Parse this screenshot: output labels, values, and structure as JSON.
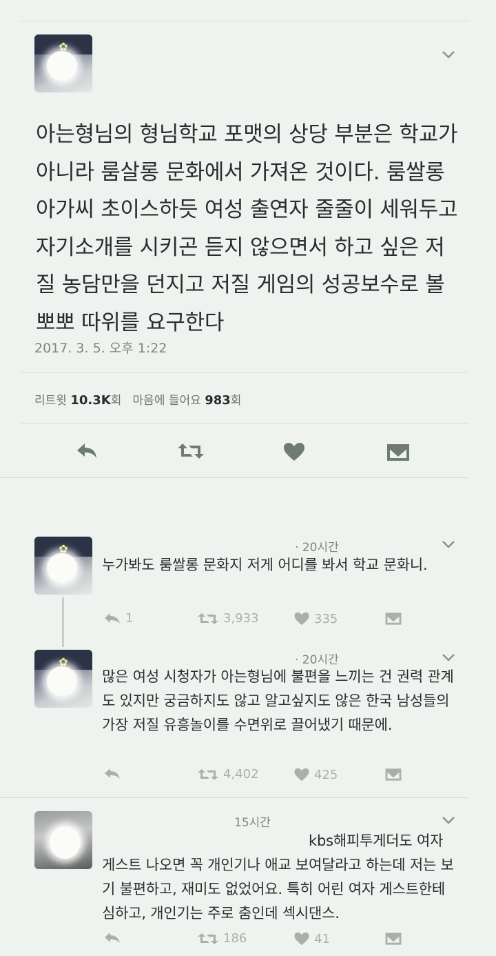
{
  "main_tweet": {
    "text": "아는형님의 형님학교 포맷의 상당 부분은 학교가 아니라 룸살롱 문화에서 가져온 것이다. 룸쌀롱 아가씨 초이스하듯 여성 출연자 줄줄이 세워두고 자기소개를 시키곤 듣지 않으면서 하고 싶은 저질 농담만을 던지고 저질 게임의 성공보수로 볼뽀뽀 따위를 요구한다",
    "timestamp": "2017. 3. 5. 오후 1:22",
    "retweet_label": "리트윗",
    "retweet_count": "10.3K",
    "count_suffix": "회",
    "like_label": "마음에 들어요",
    "like_count": "983",
    "like_suffix": "회"
  },
  "replies": [
    {
      "time": "· 20시간",
      "text": "누가봐도 룸쌀롱 문화지 저게 어디를 봐서 학교 문화니.",
      "reply_count": "1",
      "retweet_count": "3,933",
      "like_count": "335"
    },
    {
      "time": "· 20시간",
      "text": "많은 여성 시청자가 아는형님에 불편을 느끼는 건 권력 관계도 있지만 궁금하지도 않고 알고싶지도 않은 한국 남성들의 가장 저질 유흥놀이를 수면위로 끌어냈기 때문에.",
      "reply_count": "",
      "retweet_count": "4,402",
      "like_count": "425"
    },
    {
      "time": "15시간",
      "text": "kbs해피투게더도 여자 게스트 나오면 꼭 개인기나 애교 보여달라고 하는데 저는 보기 불편하고, 재미도 없었어요. 특히 어린 여자 게스트한테 심하고, 개인기는 주로 춤인데 섹시댄스.",
      "reply_count": "",
      "retweet_count": "186",
      "like_count": "41"
    }
  ],
  "icons": {
    "reply": "reply-arrow-icon",
    "retweet": "retweet-icon",
    "like": "heart-icon",
    "dm": "envelope-icon",
    "more": "chevron-down-icon"
  },
  "colors": {
    "background": "#eef3ef",
    "text": "#2b2d2c",
    "muted": "#7e8480",
    "action_icon": "#6f7a73",
    "action_icon_small": "#a9b0ab"
  }
}
